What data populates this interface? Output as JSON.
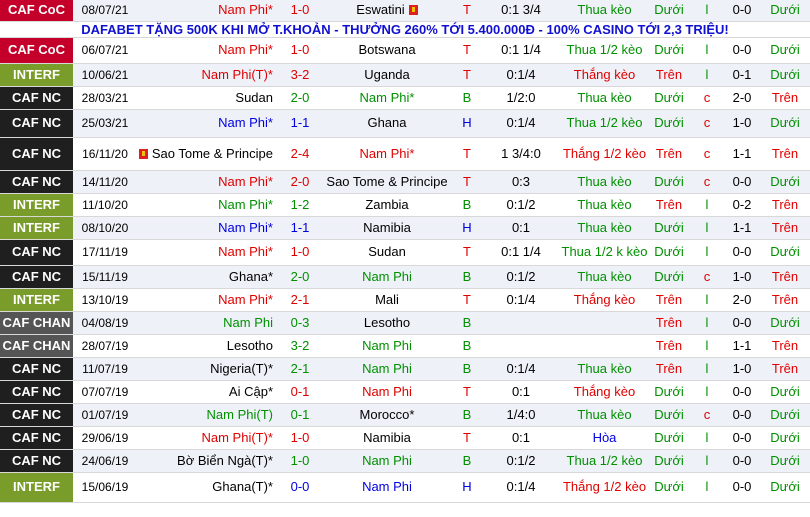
{
  "colors": {
    "CAF CoC": "#c4002a",
    "INTERF": "#7a9c2a",
    "CAF NC": "#1f1f1f",
    "CAF CHAN": "#555555"
  },
  "ad": "DAFABET TẶNG 500K KHI MỞ T.KHOẢN - THƯỞNG 260% TỚI 5.400.000Đ - 100% CASINO TỚI 2,3 TRIỆU!",
  "rows": [
    {
      "league": "CAF CoC",
      "date": "08/07/21",
      "home": "Nam Phi*",
      "hc": "red",
      "score": "1-0",
      "away": "Eswatini",
      "ac": "black",
      "aflag": true,
      "res": "T",
      "hcap": "0:1 3/4",
      "hcres": "Thua kèo",
      "ou": "Dưới",
      "ouc": "l",
      "ht": "0-0",
      "ht_ou": "Dưới"
    },
    {
      "league": "CAF CoC",
      "date": "06/07/21",
      "home": "Nam Phi*",
      "hc": "red",
      "score": "1-0",
      "away": "Botswana",
      "ac": "black",
      "res": "T",
      "hcap": "0:1 1/4",
      "hcres": "Thua 1/2 kèo",
      "ou": "Dưới",
      "ouc": "l",
      "ht": "0-0",
      "ht_ou": "Dưới"
    },
    {
      "league": "INTERF",
      "date": "10/06/21",
      "home": "Nam Phi(T)*",
      "hc": "red",
      "score": "3-2",
      "away": "Uganda",
      "ac": "black",
      "res": "T",
      "hcap": "0:1/4",
      "hcres": "Thắng kèo",
      "ou": "Trên",
      "ouc": "l",
      "ht": "0-1",
      "ht_ou": "Dưới"
    },
    {
      "league": "CAF NC",
      "date": "28/03/21",
      "home": "Sudan",
      "hc": "black",
      "score": "2-0",
      "away": "Nam Phi*",
      "ac": "green",
      "res": "B",
      "hcap": "1/2:0",
      "hcres": "Thua kèo",
      "ou": "Dưới",
      "ouc": "c",
      "ht": "2-0",
      "ht_ou": "Trên"
    },
    {
      "league": "CAF NC",
      "date": "25/03/21",
      "home": "Nam Phi*",
      "hc": "blue",
      "score": "1-1",
      "away": "Ghana",
      "ac": "black",
      "res": "H",
      "hcap": "0:1/4",
      "hcres": "Thua 1/2 kèo",
      "ou": "Dưới",
      "ouc": "c",
      "ht": "1-0",
      "ht_ou": "Dưới"
    },
    {
      "league": "CAF NC",
      "date": "16/11/20",
      "home": "Sao Tome & Principe",
      "hc": "black",
      "hflag": true,
      "score": "2-4",
      "away": "Nam Phi*",
      "ac": "red",
      "res": "T",
      "hcap": "1 3/4:0",
      "hcres": "Thắng 1/2 kèo",
      "ou": "Trên",
      "ouc": "c",
      "ht": "1-1",
      "ht_ou": "Trên"
    },
    {
      "league": "CAF NC",
      "date": "14/11/20",
      "home": "Nam Phi*",
      "hc": "red",
      "score": "2-0",
      "away": "Sao Tome & Principe",
      "ac": "black",
      "res": "T",
      "hcap": "0:3",
      "hcres": "Thua kèo",
      "ou": "Dưới",
      "ouc": "c",
      "ht": "0-0",
      "ht_ou": "Dưới"
    },
    {
      "league": "INTERF",
      "date": "11/10/20",
      "home": "Nam Phi*",
      "hc": "green",
      "score": "1-2",
      "away": "Zambia",
      "ac": "black",
      "res": "B",
      "hcap": "0:1/2",
      "hcres": "Thua kèo",
      "ou": "Trên",
      "ouc": "l",
      "ht": "0-2",
      "ht_ou": "Trên"
    },
    {
      "league": "INTERF",
      "date": "08/10/20",
      "home": "Nam Phi*",
      "hc": "blue",
      "score": "1-1",
      "away": "Namibia",
      "ac": "black",
      "res": "H",
      "hcap": "0:1",
      "hcres": "Thua kèo",
      "ou": "Dưới",
      "ouc": "l",
      "ht": "1-1",
      "ht_ou": "Trên"
    },
    {
      "league": "CAF NC",
      "date": "17/11/19",
      "home": "Nam Phi*",
      "hc": "red",
      "score": "1-0",
      "away": "Sudan",
      "ac": "black",
      "res": "T",
      "hcap": "0:1 1/4",
      "hcres": "Thua 1/2 k kèo",
      "ou": "Dưới",
      "ouc": "l",
      "ht": "0-0",
      "ht_ou": "Dưới"
    },
    {
      "league": "CAF NC",
      "date": "15/11/19",
      "home": "Ghana*",
      "hc": "black",
      "score": "2-0",
      "away": "Nam Phi",
      "ac": "green",
      "res": "B",
      "hcap": "0:1/2",
      "hcres": "Thua kèo",
      "ou": "Dưới",
      "ouc": "c",
      "ht": "1-0",
      "ht_ou": "Trên"
    },
    {
      "league": "INTERF",
      "date": "13/10/19",
      "home": "Nam Phi*",
      "hc": "red",
      "score": "2-1",
      "away": "Mali",
      "ac": "black",
      "res": "T",
      "hcap": "0:1/4",
      "hcres": "Thắng kèo",
      "ou": "Trên",
      "ouc": "l",
      "ht": "2-0",
      "ht_ou": "Trên"
    },
    {
      "league": "CAF CHAN",
      "date": "04/08/19",
      "home": "Nam Phi",
      "hc": "green",
      "score": "0-3",
      "away": "Lesotho",
      "ac": "black",
      "res": "B",
      "hcap": "",
      "hcres": "",
      "ou": "Trên",
      "ouc": "l",
      "ht": "0-0",
      "ht_ou": "Dưới"
    },
    {
      "league": "CAF CHAN",
      "date": "28/07/19",
      "home": "Lesotho",
      "hc": "black",
      "score": "3-2",
      "away": "Nam Phi",
      "ac": "green",
      "res": "B",
      "hcap": "",
      "hcres": "",
      "ou": "Trên",
      "ouc": "l",
      "ht": "1-1",
      "ht_ou": "Trên"
    },
    {
      "league": "CAF NC",
      "date": "11/07/19",
      "home": "Nigeria(T)*",
      "hc": "black",
      "score": "2-1",
      "away": "Nam Phi",
      "ac": "green",
      "res": "B",
      "hcap": "0:1/4",
      "hcres": "Thua kèo",
      "ou": "Trên",
      "ouc": "l",
      "ht": "1-0",
      "ht_ou": "Trên"
    },
    {
      "league": "CAF NC",
      "date": "07/07/19",
      "home": "Ai Cập*",
      "hc": "black",
      "score": "0-1",
      "away": "Nam Phi",
      "ac": "red",
      "res": "T",
      "hcap": "0:1",
      "hcres": "Thắng kèo",
      "ou": "Dưới",
      "ouc": "l",
      "ht": "0-0",
      "ht_ou": "Dưới"
    },
    {
      "league": "CAF NC",
      "date": "01/07/19",
      "home": "Nam Phi(T)",
      "hc": "green",
      "score": "0-1",
      "away": "Morocco*",
      "ac": "black",
      "res": "B",
      "hcap": "1/4:0",
      "hcres": "Thua kèo",
      "ou": "Dưới",
      "ouc": "c",
      "ht": "0-0",
      "ht_ou": "Dưới"
    },
    {
      "league": "CAF NC",
      "date": "29/06/19",
      "home": "Nam Phi(T)*",
      "hc": "red",
      "score": "1-0",
      "away": "Namibia",
      "ac": "black",
      "res": "T",
      "hcap": "0:1",
      "hcres": "Hòa",
      "ou": "Dưới",
      "ouc": "l",
      "ht": "0-0",
      "ht_ou": "Dưới"
    },
    {
      "league": "CAF NC",
      "date": "24/06/19",
      "home": "Bờ Biển Ngà(T)*",
      "hc": "black",
      "score": "1-0",
      "away": "Nam Phi",
      "ac": "green",
      "res": "B",
      "hcap": "0:1/2",
      "hcres": "Thua 1/2 kèo",
      "ou": "Dưới",
      "ouc": "l",
      "ht": "0-0",
      "ht_ou": "Dưới"
    },
    {
      "league": "INTERF",
      "date": "15/06/19",
      "home": "Ghana(T)*",
      "hc": "black",
      "score": "0-0",
      "away": "Nam Phi",
      "ac": "blue",
      "res": "H",
      "hcap": "0:1/4",
      "hcres": "Thắng 1/2 kèo",
      "ou": "Dưới",
      "ouc": "l",
      "ht": "0-0",
      "ht_ou": "Dưới"
    }
  ]
}
